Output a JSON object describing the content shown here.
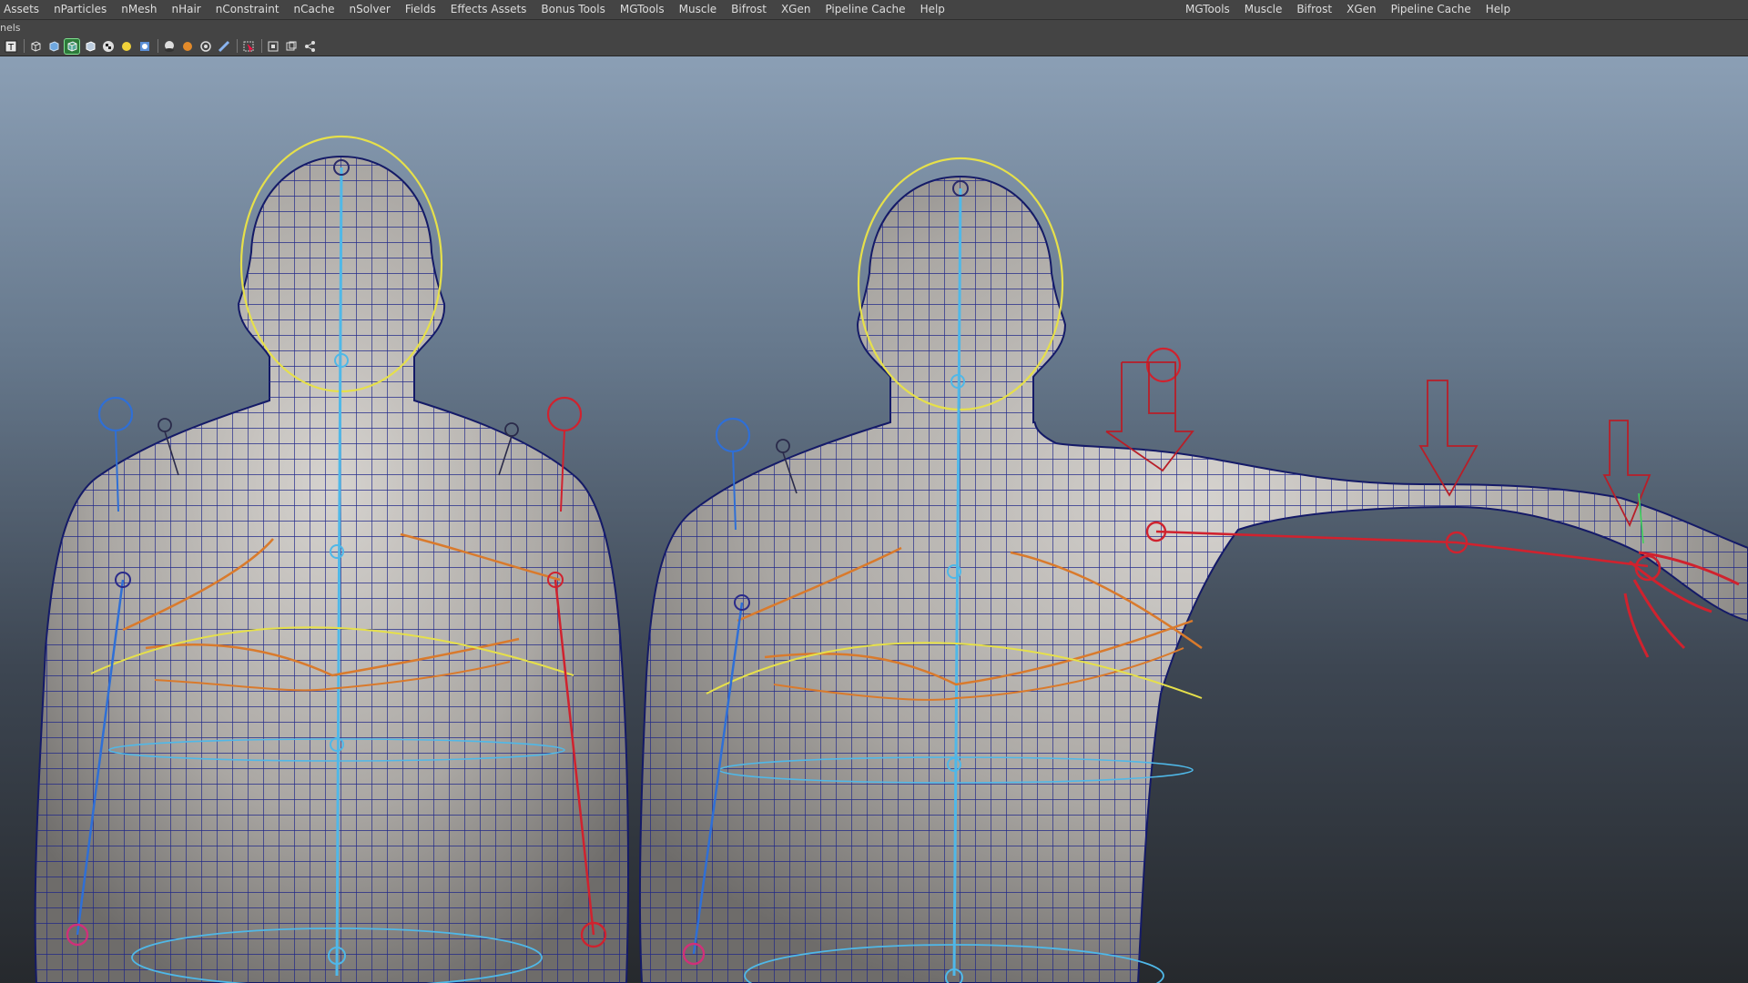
{
  "menus": {
    "left": [
      "Assets",
      "nParticles",
      "nMesh",
      "nHair",
      "nConstraint",
      "nCache",
      "nSolver",
      "Fields",
      "Effects Assets",
      "Bonus Tools",
      "MGTools",
      "Muscle",
      "Bifrost",
      "XGen",
      "Pipeline Cache",
      "Help"
    ],
    "right": [
      "MGTools",
      "Muscle",
      "Bifrost",
      "XGen",
      "Pipeline Cache",
      "Help"
    ]
  },
  "panel_bar": {
    "label": "nels"
  },
  "toolbar": {
    "items": [
      {
        "icon": "text-icon"
      },
      {
        "sep": true
      },
      {
        "icon": "wireframe-cube-icon"
      },
      {
        "icon": "smooth-shade-cube-icon"
      },
      {
        "icon": "wireframe-on-shaded-icon",
        "active": true
      },
      {
        "icon": "bounding-box-icon"
      },
      {
        "icon": "checker-texture-icon"
      },
      {
        "icon": "lighting-sun-icon"
      },
      {
        "icon": "default-light-icon"
      },
      {
        "sep": true
      },
      {
        "icon": "shadow-icon"
      },
      {
        "icon": "ambient-occlusion-icon"
      },
      {
        "icon": "motion-blur-icon"
      },
      {
        "icon": "anti-aliasing-icon"
      },
      {
        "sep": true
      },
      {
        "icon": "select-tool-icon"
      },
      {
        "sep": true
      },
      {
        "icon": "isolate-select-icon"
      },
      {
        "icon": "xray-icon"
      },
      {
        "icon": "joint-display-icon"
      }
    ]
  },
  "colors": {
    "wire": "#1c2488",
    "skin": "#b9b6b2",
    "spine": "#4fb8e8",
    "left_side": "#2f6fd6",
    "right_side": "#d0222e",
    "muscle": "#d97a2c",
    "nurbs": "#e6e04a"
  }
}
